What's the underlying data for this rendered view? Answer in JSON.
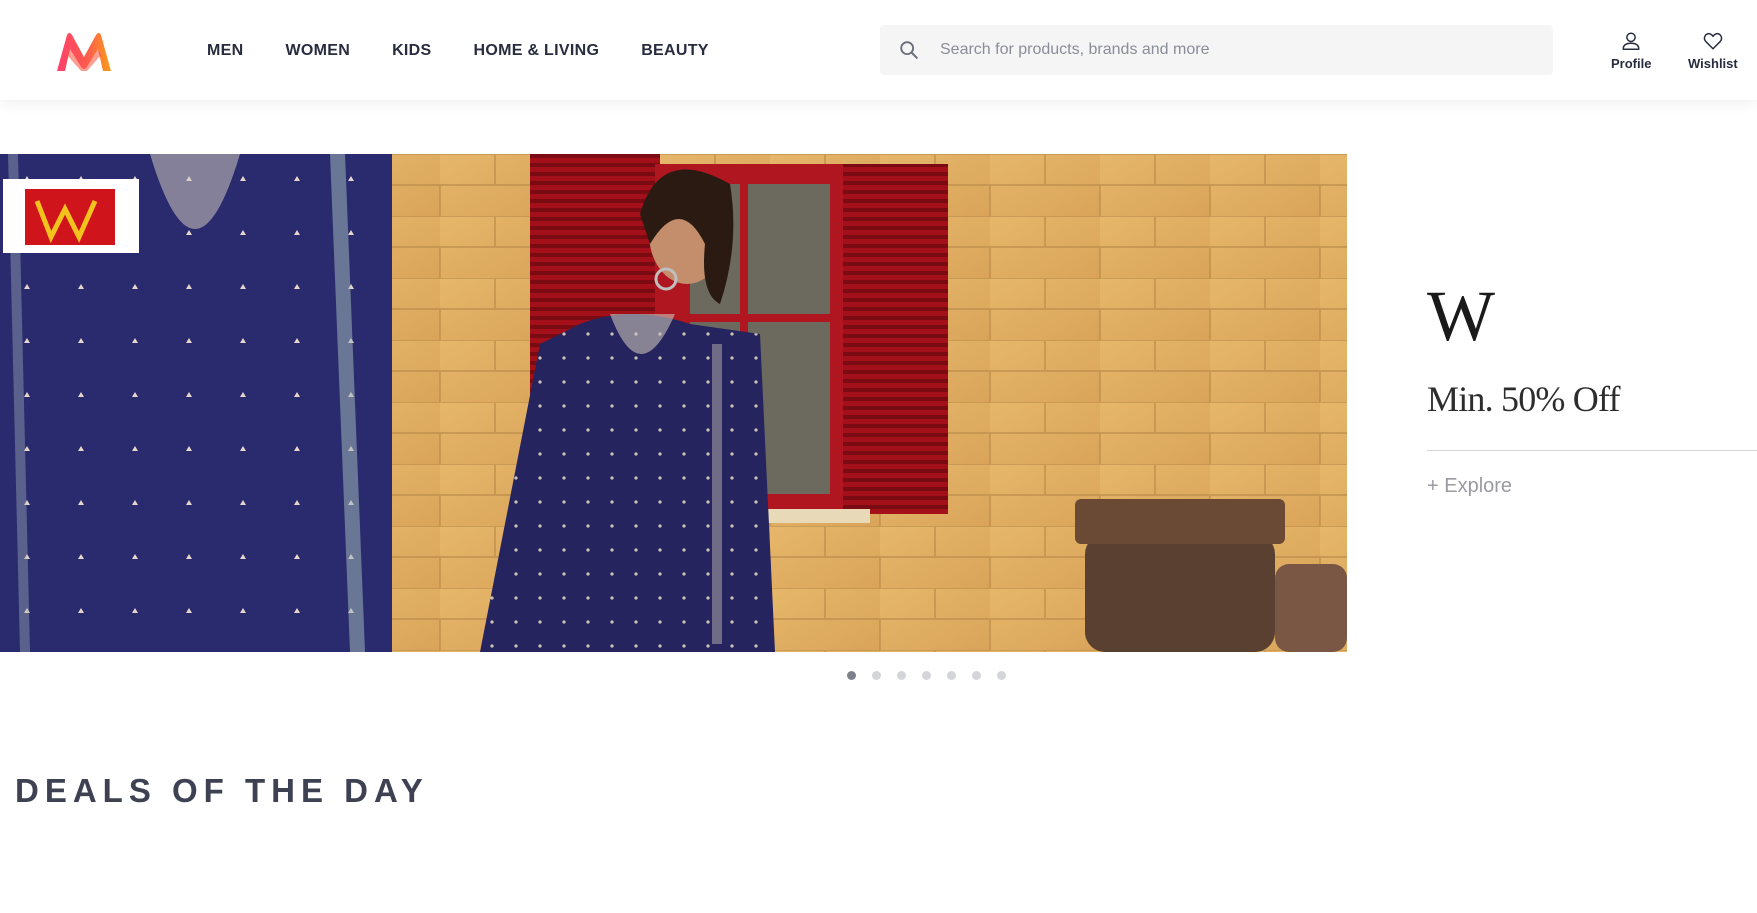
{
  "header": {
    "logo_icon": "myntra-logo-icon",
    "nav": [
      {
        "label": "MEN"
      },
      {
        "label": "WOMEN"
      },
      {
        "label": "KIDS"
      },
      {
        "label": "HOME & LIVING"
      },
      {
        "label": "BEAUTY"
      }
    ],
    "search": {
      "placeholder": "Search for products, brands and more",
      "value": "",
      "icon": "search-icon"
    },
    "actions": {
      "profile_label": "Profile",
      "profile_icon": "user-icon",
      "wishlist_label": "Wishlist",
      "wishlist_icon": "heart-icon"
    }
  },
  "banner": {
    "side_brand": "W",
    "offer": "Min. 50% Off",
    "explore": "+ Explore",
    "slide_count": 7,
    "active_slide": 1
  },
  "section": {
    "title": "DEALS OF THE DAY"
  },
  "colors": {
    "brand_pink": "#ff3f6c",
    "brand_orange": "#f89d1b",
    "text_dark": "#282c3f",
    "search_bg": "#f5f5f6",
    "dot_active": "#7e818c",
    "dot_inactive": "#d4d5d9"
  }
}
